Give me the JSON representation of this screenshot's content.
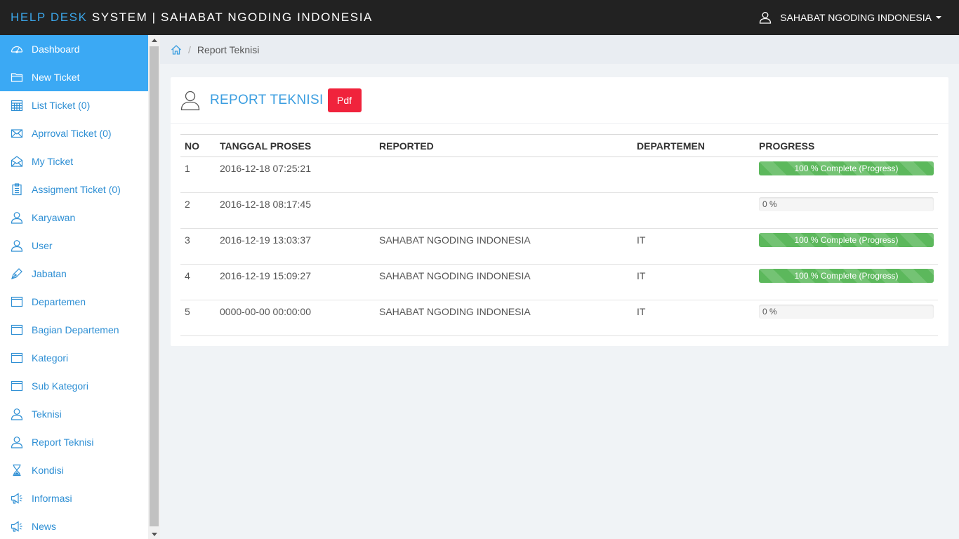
{
  "header": {
    "brand_accent": "HELP DESK",
    "brand_rest": " SYSTEM | SAHABAT NGODING INDONESIA",
    "user_name": "SAHABAT NGODING INDONESIA"
  },
  "sidebar": {
    "items": [
      {
        "label": "Dashboard",
        "icon": "dashboard-icon"
      },
      {
        "label": "New Ticket",
        "icon": "folder-icon"
      },
      {
        "label": "List Ticket (0)",
        "icon": "calendar-icon"
      },
      {
        "label": "Aprroval Ticket (0)",
        "icon": "envelope-icon"
      },
      {
        "label": "My Ticket",
        "icon": "envelope-open-icon"
      },
      {
        "label": "Assigment Ticket (0)",
        "icon": "clipboard-icon"
      },
      {
        "label": "Karyawan",
        "icon": "user-icon"
      },
      {
        "label": "User",
        "icon": "user-icon"
      },
      {
        "label": "Jabatan",
        "icon": "pen-icon"
      },
      {
        "label": "Departemen",
        "icon": "window-icon"
      },
      {
        "label": "Bagian Departemen",
        "icon": "window-icon"
      },
      {
        "label": "Kategori",
        "icon": "window-icon"
      },
      {
        "label": "Sub Kategori",
        "icon": "window-icon"
      },
      {
        "label": "Teknisi",
        "icon": "user-icon"
      },
      {
        "label": "Report Teknisi",
        "icon": "user-icon"
      },
      {
        "label": "Kondisi",
        "icon": "hourglass-icon"
      },
      {
        "label": "Informasi",
        "icon": "megaphone-icon"
      },
      {
        "label": "News",
        "icon": "megaphone-icon"
      }
    ]
  },
  "breadcrumb": {
    "current": "Report Teknisi"
  },
  "panel": {
    "title": "REPORT TEKNISI",
    "pdf_label": "Pdf"
  },
  "table": {
    "columns": [
      "NO",
      "TANGGAL PROSES",
      "REPORTED",
      "DEPARTEMEN",
      "PROGRESS"
    ],
    "rows": [
      {
        "no": "1",
        "tanggal": "2016-12-18 07:25:21",
        "reported": "",
        "departemen": "",
        "progress": 100,
        "progress_label": "100 % Complete (Progress)"
      },
      {
        "no": "2",
        "tanggal": "2016-12-18 08:17:45",
        "reported": "",
        "departemen": "",
        "progress": 0,
        "progress_label": "0 %"
      },
      {
        "no": "3",
        "tanggal": "2016-12-19 13:03:37",
        "reported": "SAHABAT NGODING INDONESIA",
        "departemen": "IT",
        "progress": 100,
        "progress_label": "100 % Complete (Progress)"
      },
      {
        "no": "4",
        "tanggal": "2016-12-19 15:09:27",
        "reported": "SAHABAT NGODING INDONESIA",
        "departemen": "IT",
        "progress": 100,
        "progress_label": "100 % Complete (Progress)"
      },
      {
        "no": "5",
        "tanggal": "0000-00-00 00:00:00",
        "reported": "SAHABAT NGODING INDONESIA",
        "departemen": "IT",
        "progress": 0,
        "progress_label": "0 %"
      }
    ]
  },
  "colors": {
    "accent": "#3ba9f4",
    "topbar": "#222222",
    "pdf": "#f0233c",
    "progress": "#5cb85c"
  }
}
